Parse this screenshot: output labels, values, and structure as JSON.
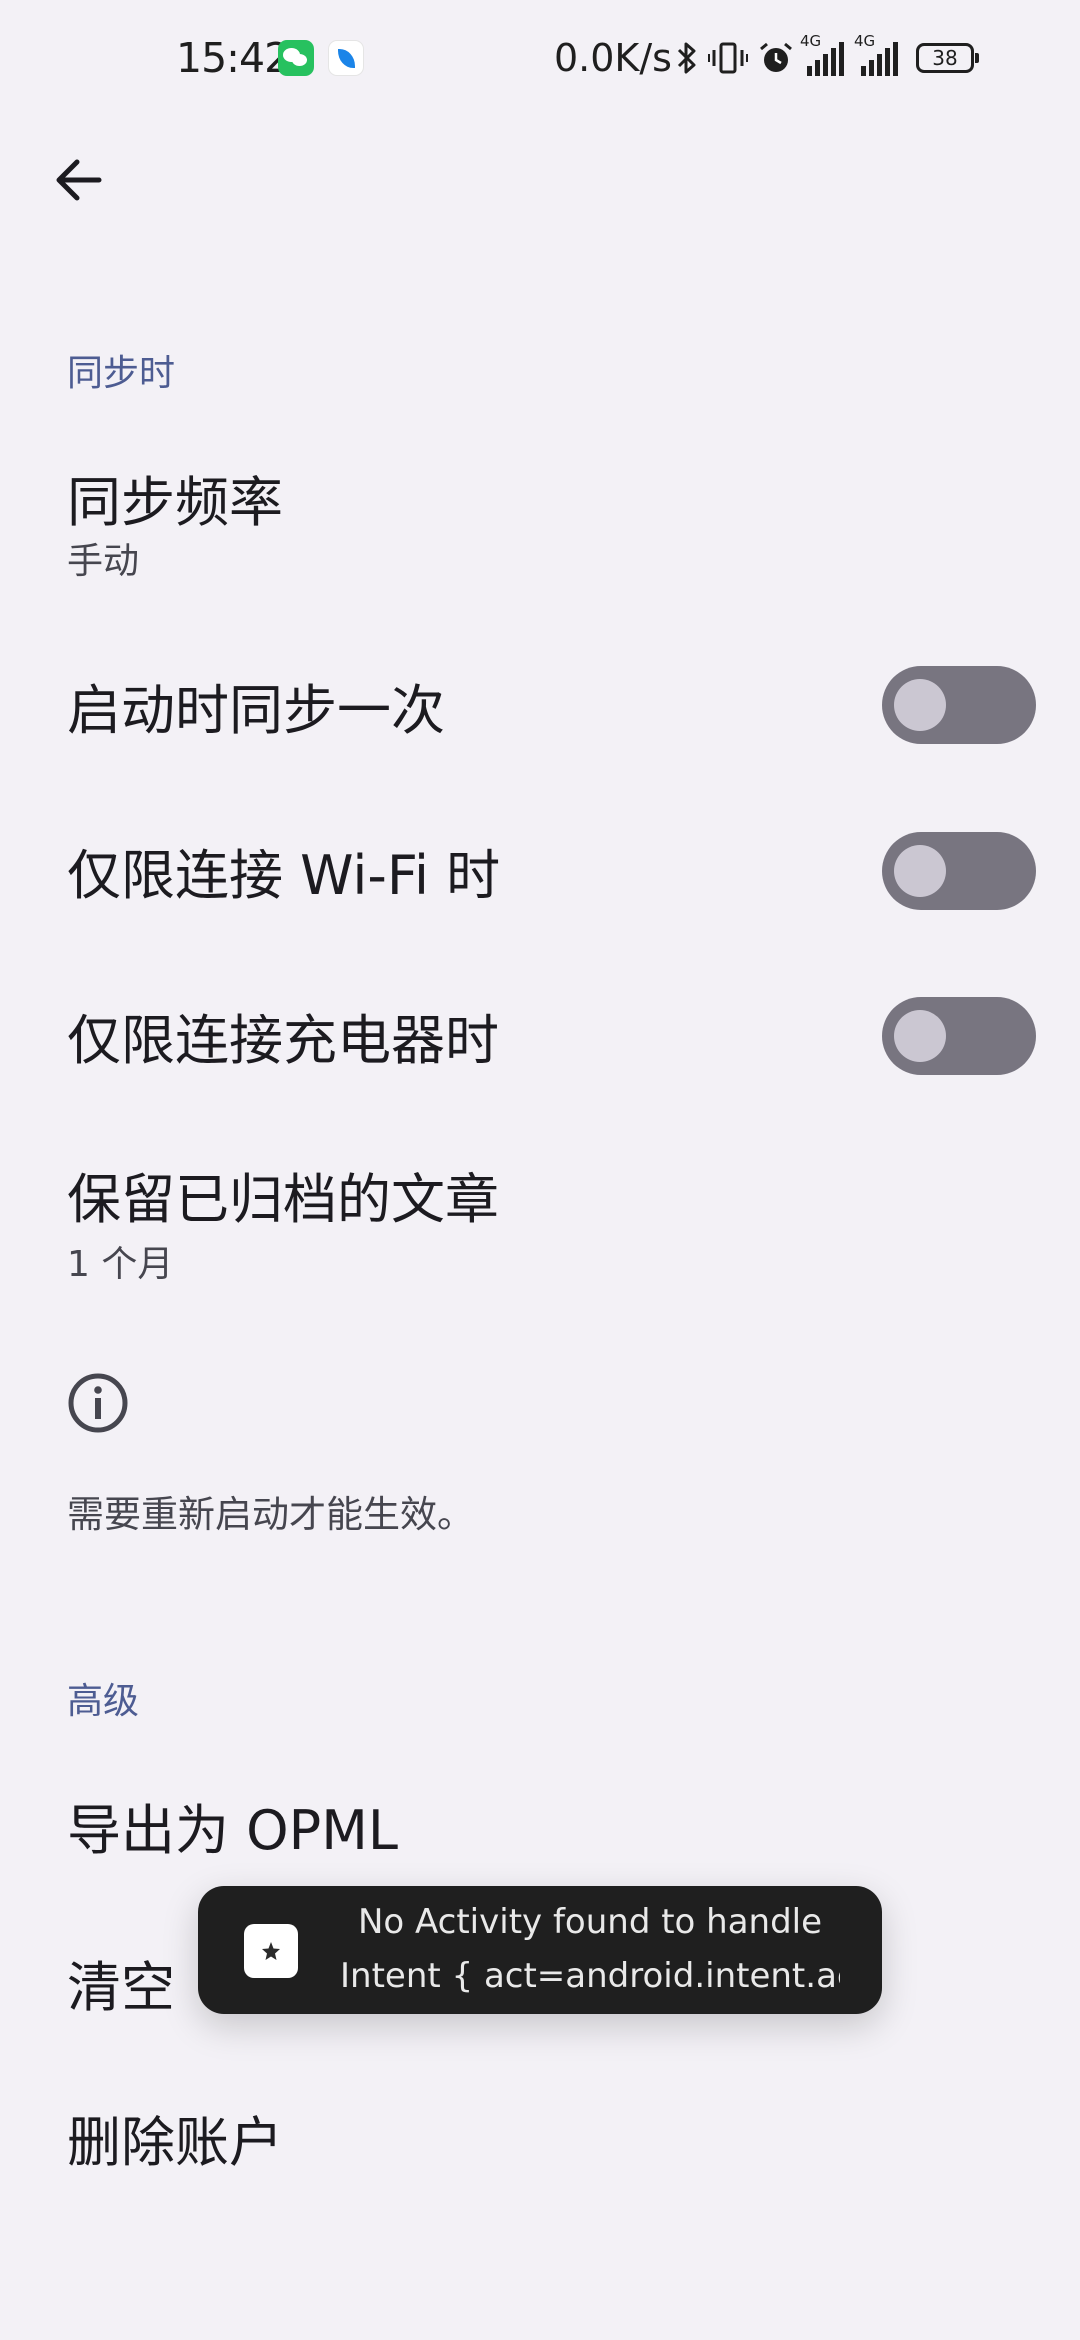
{
  "status_bar": {
    "time": "15:42",
    "network_speed": "0.0K/s",
    "signal_1_label": "4G",
    "signal_2_label": "4G",
    "battery_level": "38",
    "icons": [
      "wechat-icon",
      "leaf-app-icon",
      "bluetooth-icon",
      "vibrate-icon",
      "alarm-icon",
      "signal-icon",
      "signal-icon",
      "battery-icon"
    ]
  },
  "app_bar": {
    "back_icon": "arrow-left-icon"
  },
  "sections": {
    "sync_header": "同步时",
    "advanced_header": "高级"
  },
  "sync": {
    "frequency_title": "同步频率",
    "frequency_value": "手动",
    "sync_on_start_title": "启动时同步一次",
    "sync_on_start_enabled": false,
    "wifi_only_title": "仅限连接 Wi-Fi 时",
    "wifi_only_enabled": false,
    "charging_only_title": "仅限连接充电器时",
    "charging_only_enabled": false,
    "keep_archived_title": "保留已归档的文章",
    "keep_archived_value": "1 个月",
    "info_icon": "info-icon",
    "restart_note": "需要重新启动才能生效。"
  },
  "advanced": {
    "export_opml": "导出为 OPML",
    "clear_partial": "清空",
    "delete_account": "删除账户"
  },
  "toast": {
    "line1": "No Activity found to handle",
    "line2": "Intent { act=android.intent.acti...",
    "app_icon": "app-icon"
  },
  "colors": {
    "background": "#f3f1f6",
    "accent": "#4d5c92",
    "switch_track_off": "#787580",
    "toast_background": "#1f1f1f"
  }
}
